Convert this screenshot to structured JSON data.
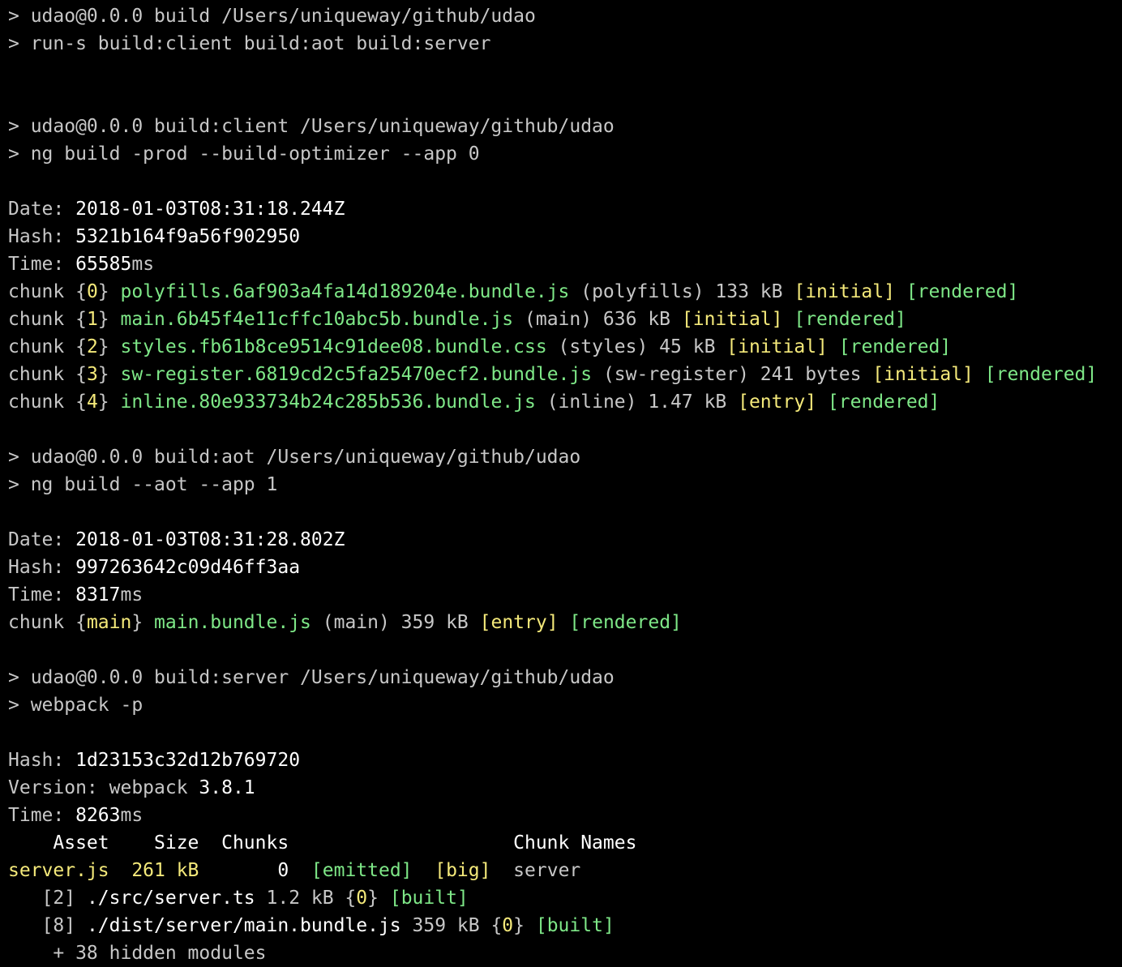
{
  "colors": {
    "background": "#000000",
    "default": "#c7c7c7",
    "white": "#ffffff",
    "green": "#7ee787",
    "yellow": "#f4e97a"
  },
  "terminal": {
    "lines": [
      {
        "segments": [
          {
            "text": "> udao@0.0.0 build /Users/uniqueway/github/udao",
            "color": "default"
          }
        ]
      },
      {
        "segments": [
          {
            "text": "> run-s build:client build:aot build:server",
            "color": "default"
          }
        ]
      },
      {
        "segments": []
      },
      {
        "segments": []
      },
      {
        "segments": [
          {
            "text": "> udao@0.0.0 build:client /Users/uniqueway/github/udao",
            "color": "default"
          }
        ]
      },
      {
        "segments": [
          {
            "text": "> ng build -prod --build-optimizer --app 0",
            "color": "default"
          }
        ]
      },
      {
        "segments": []
      },
      {
        "segments": [
          {
            "text": "Date: ",
            "color": "default"
          },
          {
            "text": "2018-01-03T08:31:18.244Z",
            "color": "white"
          }
        ]
      },
      {
        "segments": [
          {
            "text": "Hash: ",
            "color": "default"
          },
          {
            "text": "5321b164f9a56f902950",
            "color": "white"
          }
        ]
      },
      {
        "segments": [
          {
            "text": "Time: ",
            "color": "default"
          },
          {
            "text": "65585",
            "color": "white"
          },
          {
            "text": "ms",
            "color": "default"
          }
        ]
      },
      {
        "segments": [
          {
            "text": "chunk {",
            "color": "default"
          },
          {
            "text": "0",
            "color": "yellow"
          },
          {
            "text": "} ",
            "color": "default"
          },
          {
            "text": "polyfills.6af903a4fa14d189204e.bundle.js",
            "color": "green"
          },
          {
            "text": " (polyfills) 133 kB ",
            "color": "default"
          },
          {
            "text": "[initial]",
            "color": "yellow"
          },
          {
            "text": " ",
            "color": "default"
          },
          {
            "text": "[rendered]",
            "color": "green"
          }
        ]
      },
      {
        "segments": [
          {
            "text": "chunk {",
            "color": "default"
          },
          {
            "text": "1",
            "color": "yellow"
          },
          {
            "text": "} ",
            "color": "default"
          },
          {
            "text": "main.6b45f4e11cffc10abc5b.bundle.js",
            "color": "green"
          },
          {
            "text": " (main) 636 kB ",
            "color": "default"
          },
          {
            "text": "[initial]",
            "color": "yellow"
          },
          {
            "text": " ",
            "color": "default"
          },
          {
            "text": "[rendered]",
            "color": "green"
          }
        ]
      },
      {
        "segments": [
          {
            "text": "chunk {",
            "color": "default"
          },
          {
            "text": "2",
            "color": "yellow"
          },
          {
            "text": "} ",
            "color": "default"
          },
          {
            "text": "styles.fb61b8ce9514c91dee08.bundle.css",
            "color": "green"
          },
          {
            "text": " (styles) 45 kB ",
            "color": "default"
          },
          {
            "text": "[initial]",
            "color": "yellow"
          },
          {
            "text": " ",
            "color": "default"
          },
          {
            "text": "[rendered]",
            "color": "green"
          }
        ]
      },
      {
        "segments": [
          {
            "text": "chunk {",
            "color": "default"
          },
          {
            "text": "3",
            "color": "yellow"
          },
          {
            "text": "} ",
            "color": "default"
          },
          {
            "text": "sw-register.6819cd2c5fa25470ecf2.bundle.js",
            "color": "green"
          },
          {
            "text": " (sw-register) 241 bytes ",
            "color": "default"
          },
          {
            "text": "[initial]",
            "color": "yellow"
          },
          {
            "text": " ",
            "color": "default"
          },
          {
            "text": "[rendered]",
            "color": "green"
          }
        ]
      },
      {
        "segments": [
          {
            "text": "chunk {",
            "color": "default"
          },
          {
            "text": "4",
            "color": "yellow"
          },
          {
            "text": "} ",
            "color": "default"
          },
          {
            "text": "inline.80e933734b24c285b536.bundle.js",
            "color": "green"
          },
          {
            "text": " (inline) 1.47 kB ",
            "color": "default"
          },
          {
            "text": "[entry]",
            "color": "yellow"
          },
          {
            "text": " ",
            "color": "default"
          },
          {
            "text": "[rendered]",
            "color": "green"
          }
        ]
      },
      {
        "segments": []
      },
      {
        "segments": [
          {
            "text": "> udao@0.0.0 build:aot /Users/uniqueway/github/udao",
            "color": "default"
          }
        ]
      },
      {
        "segments": [
          {
            "text": "> ng build --aot --app 1",
            "color": "default"
          }
        ]
      },
      {
        "segments": []
      },
      {
        "segments": [
          {
            "text": "Date: ",
            "color": "default"
          },
          {
            "text": "2018-01-03T08:31:28.802Z",
            "color": "white"
          }
        ]
      },
      {
        "segments": [
          {
            "text": "Hash: ",
            "color": "default"
          },
          {
            "text": "997263642c09d46ff3aa",
            "color": "white"
          }
        ]
      },
      {
        "segments": [
          {
            "text": "Time: ",
            "color": "default"
          },
          {
            "text": "8317",
            "color": "white"
          },
          {
            "text": "ms",
            "color": "default"
          }
        ]
      },
      {
        "segments": [
          {
            "text": "chunk {",
            "color": "default"
          },
          {
            "text": "main",
            "color": "yellow"
          },
          {
            "text": "} ",
            "color": "default"
          },
          {
            "text": "main.bundle.js",
            "color": "green"
          },
          {
            "text": " (main) 359 kB ",
            "color": "default"
          },
          {
            "text": "[entry]",
            "color": "yellow"
          },
          {
            "text": " ",
            "color": "default"
          },
          {
            "text": "[rendered]",
            "color": "green"
          }
        ]
      },
      {
        "segments": []
      },
      {
        "segments": [
          {
            "text": "> udao@0.0.0 build:server /Users/uniqueway/github/udao",
            "color": "default"
          }
        ]
      },
      {
        "segments": [
          {
            "text": "> webpack -p",
            "color": "default"
          }
        ]
      },
      {
        "segments": []
      },
      {
        "segments": [
          {
            "text": "Hash: ",
            "color": "default"
          },
          {
            "text": "1d23153c32d12b769720",
            "color": "white"
          }
        ]
      },
      {
        "segments": [
          {
            "text": "Version: webpack ",
            "color": "default"
          },
          {
            "text": "3.8.1",
            "color": "white"
          }
        ]
      },
      {
        "segments": [
          {
            "text": "Time: ",
            "color": "default"
          },
          {
            "text": "8263",
            "color": "white"
          },
          {
            "text": "ms",
            "color": "default"
          }
        ]
      },
      {
        "segments": [
          {
            "text": "    Asset    Size  Chunks                    Chunk Names",
            "color": "white"
          }
        ]
      },
      {
        "segments": [
          {
            "text": "server.js  261 kB",
            "color": "yellow"
          },
          {
            "text": "       ",
            "color": "default"
          },
          {
            "text": "0",
            "color": "white"
          },
          {
            "text": "  ",
            "color": "default"
          },
          {
            "text": "[emitted]",
            "color": "green"
          },
          {
            "text": "  ",
            "color": "default"
          },
          {
            "text": "[big]",
            "color": "yellow"
          },
          {
            "text": "  server",
            "color": "default"
          }
        ]
      },
      {
        "segments": [
          {
            "text": "   [2] ",
            "color": "default"
          },
          {
            "text": "./src/server.ts",
            "color": "white"
          },
          {
            "text": " 1.2 kB {",
            "color": "default"
          },
          {
            "text": "0",
            "color": "yellow"
          },
          {
            "text": "} ",
            "color": "default"
          },
          {
            "text": "[built]",
            "color": "green"
          }
        ]
      },
      {
        "segments": [
          {
            "text": "   [8] ",
            "color": "default"
          },
          {
            "text": "./dist/server/main.bundle.js",
            "color": "white"
          },
          {
            "text": " 359 kB {",
            "color": "default"
          },
          {
            "text": "0",
            "color": "yellow"
          },
          {
            "text": "} ",
            "color": "default"
          },
          {
            "text": "[built]",
            "color": "green"
          }
        ]
      },
      {
        "segments": [
          {
            "text": "    + 38 hidden modules",
            "color": "default"
          }
        ]
      }
    ]
  }
}
